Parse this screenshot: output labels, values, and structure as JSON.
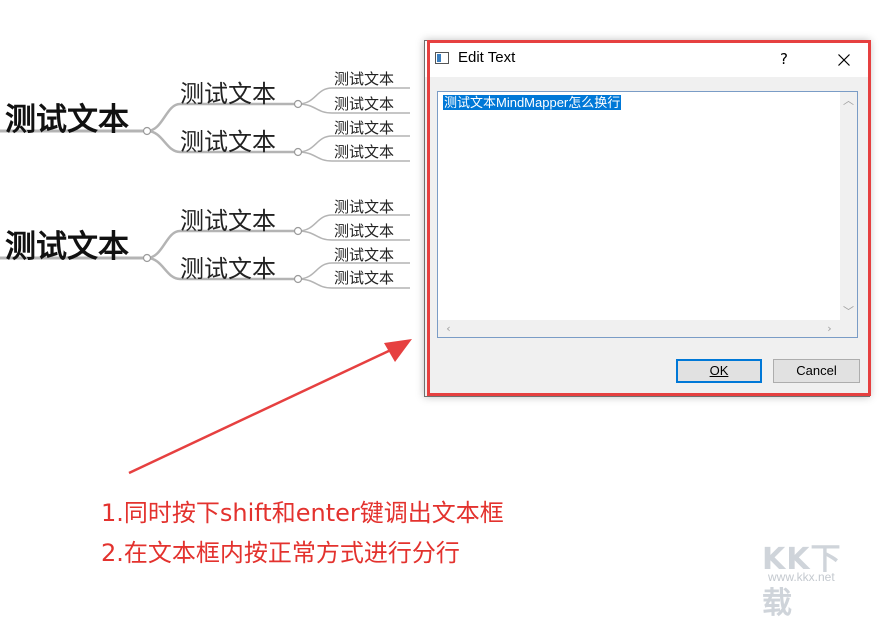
{
  "mindmap": {
    "groups": [
      {
        "root": "测试文本",
        "branches": [
          {
            "label": "测试文本",
            "leaves": [
              "测试文本",
              "测试文本"
            ]
          },
          {
            "label": "测试文本",
            "leaves": [
              "测试文本",
              "测试文本"
            ]
          }
        ]
      },
      {
        "root": "测试文本",
        "branches": [
          {
            "label": "测试文本",
            "leaves": [
              "测试文本",
              "测试文本"
            ]
          },
          {
            "label": "测试文本",
            "leaves": [
              "测试文本",
              "测试文本"
            ]
          }
        ]
      }
    ]
  },
  "dialog": {
    "title": "Edit Text",
    "help_label": "?",
    "text_value": "测试文本MindMapper怎么换行",
    "ok_label": "OK",
    "cancel_label": "Cancel",
    "highlight_color": "#e64040",
    "accent_color": "#0078d7"
  },
  "annotation": {
    "line1": "1.同时按下shift和enter键调出文本框",
    "line2": "2.在文本框内按正常方式进行分行",
    "color": "#e3322e"
  },
  "watermark": {
    "logo": "KK下载",
    "url": "www.kkx.net"
  }
}
